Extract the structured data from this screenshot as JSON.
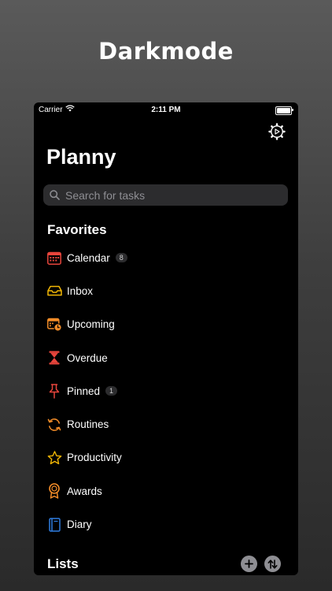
{
  "headline": "Darkmode",
  "status_bar": {
    "carrier": "Carrier",
    "time": "2:11 PM"
  },
  "app": {
    "title": "Planny"
  },
  "search": {
    "placeholder": "Search for tasks"
  },
  "favorites": {
    "title": "Favorites",
    "items": [
      {
        "label": "Calendar",
        "icon": "calendar-icon",
        "color": "#e8453c",
        "badge": "8"
      },
      {
        "label": "Inbox",
        "icon": "inbox-icon",
        "color": "#f2b705"
      },
      {
        "label": "Upcoming",
        "icon": "upcoming-icon",
        "color": "#f28c28"
      },
      {
        "label": "Overdue",
        "icon": "hourglass-icon",
        "color": "#e8453c"
      },
      {
        "label": "Pinned",
        "icon": "pin-icon",
        "color": "#e8453c",
        "badge": "1"
      },
      {
        "label": "Routines",
        "icon": "routines-icon",
        "color": "#f28c28"
      },
      {
        "label": "Productivity",
        "icon": "star-icon",
        "color": "#f2b705"
      },
      {
        "label": "Awards",
        "icon": "award-icon",
        "color": "#f28c28"
      },
      {
        "label": "Diary",
        "icon": "book-icon",
        "color": "#2f7de1"
      }
    ]
  },
  "lists": {
    "title": "Lists"
  },
  "colors": {
    "background": "#000000",
    "accent_red": "#e8453c",
    "accent_orange": "#f28c28",
    "accent_yellow": "#f2b705",
    "accent_blue": "#2f7de1"
  }
}
